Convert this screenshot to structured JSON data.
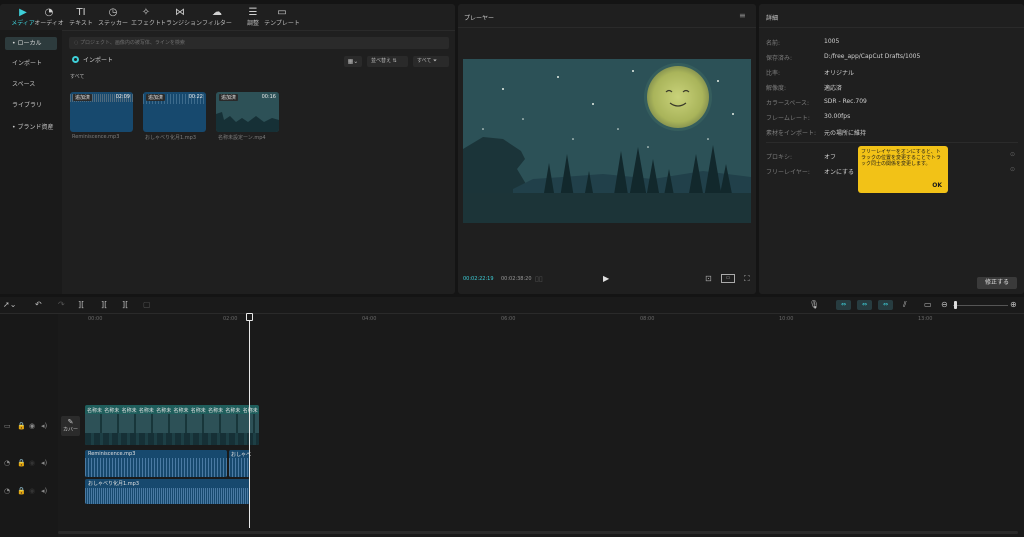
{
  "toolbar": {
    "tabs": [
      {
        "label": "メディア",
        "icon": "▶",
        "active": true
      },
      {
        "label": "オーディオ",
        "icon": "◔",
        "active": false
      },
      {
        "label": "テキスト",
        "icon": "TI",
        "active": false
      },
      {
        "label": "ステッカー",
        "icon": "◷",
        "active": false
      },
      {
        "label": "エフェクト",
        "icon": "✧",
        "active": false
      },
      {
        "label": "トランジション",
        "icon": "⋈",
        "active": false
      },
      {
        "label": "フィルター",
        "icon": "☁",
        "active": false
      },
      {
        "label": "調整",
        "icon": "☰",
        "active": false
      },
      {
        "label": "テンプレート",
        "icon": "▭",
        "active": false
      }
    ]
  },
  "media": {
    "sidebar": [
      "• ローカル",
      "インポート",
      "スペース",
      "ライブラリ",
      "• ブランド資産"
    ],
    "search_placeholder": "◌ プロジェクト、画像内の被写体、ラインを検索",
    "import_label": "インポート",
    "sort_label": "並べ替え",
    "filter_label": "すべて",
    "all_label": "すべて",
    "items": [
      {
        "badge": "追加済",
        "duration": "02:09",
        "name": "Reminiscence.mp3"
      },
      {
        "badge": "追加済",
        "duration": "00:22",
        "name": "おしゃべり化月1.mp3"
      },
      {
        "badge": "追加済",
        "duration": "00:16",
        "name": "名称未設定ーン.mp4"
      }
    ]
  },
  "player": {
    "title": "プレーヤー",
    "current_time": "00:02:22:19",
    "total_time": "00:02:38:20"
  },
  "details": {
    "title": "詳細",
    "rows": [
      {
        "label": "名前:",
        "value": "1005"
      },
      {
        "label": "保存済み:",
        "value": "D:/free_app/CapCut Drafts/1005"
      },
      {
        "label": "比率:",
        "value": "オリジナル"
      },
      {
        "label": "解像度:",
        "value": "適応済"
      },
      {
        "label": "カラースペース:",
        "value": "SDR - Rec.709"
      },
      {
        "label": "フレームレート:",
        "value": "30.00fps"
      },
      {
        "label": "素材をインポート:",
        "value": "元の場所に維持"
      }
    ],
    "proxy_label": "プロキシ:",
    "proxy_value": "オフ",
    "freelayer_label": "フリーレイヤー:",
    "freelayer_value": "オンにする",
    "tooltip_text": "フリーレイヤーをオンにすると、トラックの位置を変更することでトラック同士の関係を変更します。",
    "tooltip_ok": "OK",
    "edit_button": "修正する"
  },
  "timeline": {
    "ruler": [
      "00:00",
      "02:00",
      "04:00",
      "06:00",
      "08:00",
      "10:00",
      "13:00"
    ],
    "cover_label": "カバー",
    "video_clip_label": "名称未",
    "audio1_label": "Reminiscence.mp3",
    "audio1b_label": "おしゃべ",
    "audio2_label": "おしゃべり化月1.mp3"
  },
  "colors": {
    "accent": "#3ecfd8",
    "tooltip": "#f2c217",
    "video_clip": "#1f5e5c",
    "audio_clip": "#17496e"
  }
}
